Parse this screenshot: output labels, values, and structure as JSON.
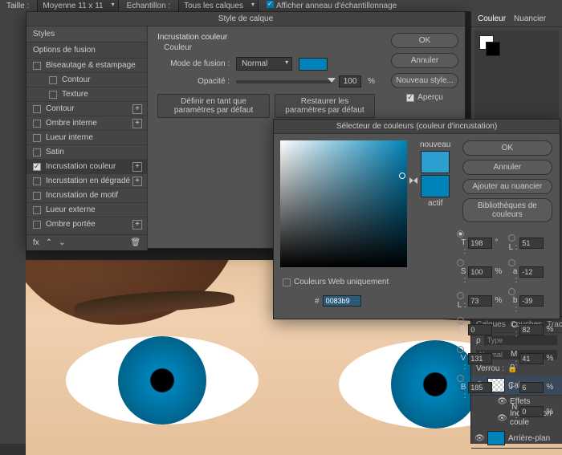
{
  "topbar": {
    "taille": "Taille :",
    "taille_val": "Moyenne 11 x 11",
    "echant": "Echantillon :",
    "echant_val": "Tous les calques",
    "ring": "Afficher anneau d'échantillonnage"
  },
  "style_dlg": {
    "title": "Style de calque",
    "styles_hdr": "Styles",
    "blend_hdr": "Options de fusion",
    "rows": [
      {
        "label": "Biseautage & estampage",
        "checked": false,
        "plus": false
      },
      {
        "label": "Contour",
        "checked": false,
        "plus": false,
        "indent": true
      },
      {
        "label": "Texture",
        "checked": false,
        "plus": false,
        "indent": true
      },
      {
        "label": "Contour",
        "checked": false,
        "plus": true
      },
      {
        "label": "Ombre interne",
        "checked": false,
        "plus": true
      },
      {
        "label": "Lueur interne",
        "checked": false,
        "plus": false
      },
      {
        "label": "Satin",
        "checked": false,
        "plus": false
      },
      {
        "label": "Incrustation couleur",
        "checked": true,
        "plus": true,
        "sel": true
      },
      {
        "label": "Incrustation en dégradé",
        "checked": false,
        "plus": true
      },
      {
        "label": "Incrustation de motif",
        "checked": false,
        "plus": false
      },
      {
        "label": "Lueur externe",
        "checked": false,
        "plus": false
      },
      {
        "label": "Ombre portée",
        "checked": false,
        "plus": true
      }
    ],
    "fx_label": "fx",
    "mid": {
      "section": "Incrustation couleur",
      "sub": "Couleur",
      "mode": "Mode de fusion :",
      "mode_val": "Normal",
      "opacity": "Opacité :",
      "opacity_val": "100",
      "pct": "%",
      "def": "Définir en tant que paramètres par défaut",
      "reset": "Restaurer les paramètres par défaut"
    },
    "right": {
      "ok": "OK",
      "cancel": "Annuler",
      "new": "Nouveau style...",
      "preview": "Aperçu"
    }
  },
  "color_dlg": {
    "title": "Sélecteur de couleurs (couleur d'incrustation)",
    "new": "nouveau",
    "cur": "actif",
    "ok": "OK",
    "cancel": "Annuler",
    "add": "Ajouter au nuancier",
    "libs": "Bibliothèques de couleurs",
    "web": "Couleurs Web uniquement",
    "hex": "0083b9",
    "vals": {
      "T": "198",
      "S": "100",
      "Lhsl": "73",
      "R": "0",
      "V": "131",
      "B": "185",
      "L": "51",
      "a": "-12",
      "b": "-39",
      "C": "82",
      "M": "41",
      "J": "6",
      "N": "0"
    }
  },
  "rpanel": {
    "tabs": [
      "Couleur",
      "Nuancier"
    ],
    "layers": {
      "tabs": [
        "Calques",
        "Couches",
        "Tracés"
      ],
      "type": "Type",
      "mode": "Normal",
      "lock": "Verrou :",
      "layer1": "Calque 1",
      "fx": "Effets",
      "fx1": "Incrustation coule",
      "bg": "Arrière-plan"
    }
  }
}
